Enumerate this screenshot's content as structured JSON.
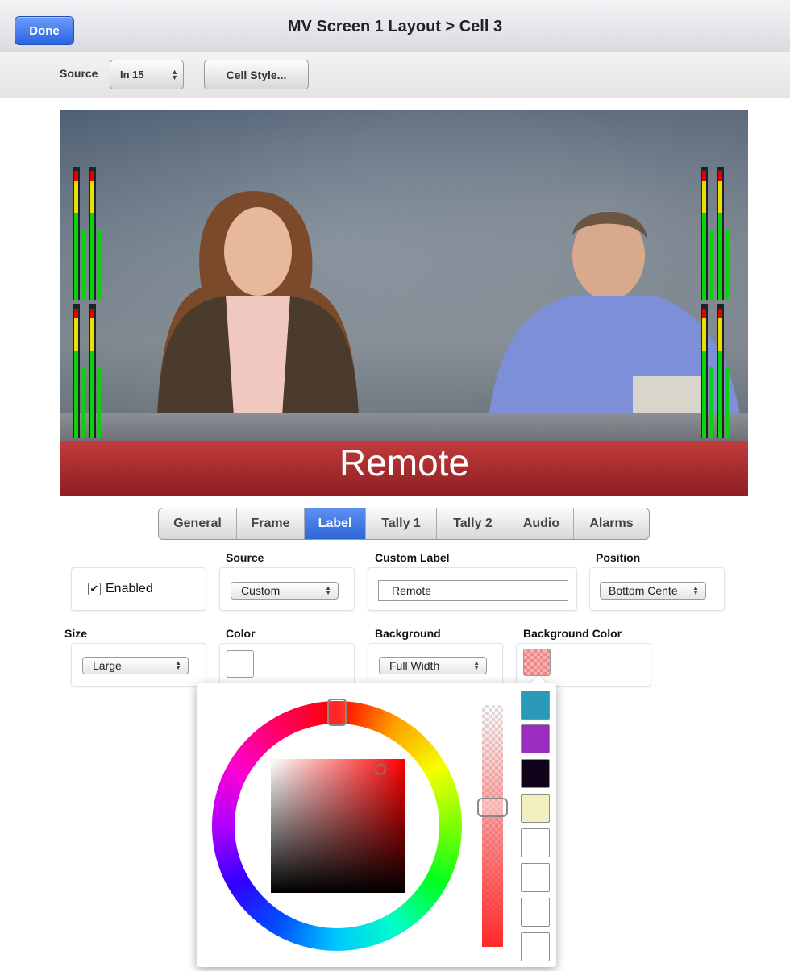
{
  "header": {
    "done_label": "Done",
    "title": "MV Screen 1 Layout > Cell 3"
  },
  "toolbar": {
    "source_label": "Source",
    "source_value": "In 15",
    "cell_style_label": "Cell Style..."
  },
  "preview": {
    "label_text": "Remote",
    "label_color": "#ffffff",
    "band_color": "#b03030"
  },
  "tabs": [
    {
      "label": "General",
      "active": false
    },
    {
      "label": "Frame",
      "active": false
    },
    {
      "label": "Label",
      "active": true
    },
    {
      "label": "Tally 1",
      "active": false
    },
    {
      "label": "Tally 2",
      "active": false
    },
    {
      "label": "Audio",
      "active": false
    },
    {
      "label": "Alarms",
      "active": false
    }
  ],
  "label_settings": {
    "enabled_label": "Enabled",
    "enabled_checked": true,
    "source_heading": "Source",
    "source_value": "Custom",
    "custom_label_heading": "Custom Label",
    "custom_label_value": "Remote",
    "position_heading": "Position",
    "position_value": "Bottom Centе",
    "size_heading": "Size",
    "size_value": "Large",
    "color_heading": "Color",
    "color_value": "#ffffff",
    "background_heading": "Background",
    "background_value": "Full Width",
    "background_color_heading": "Background Color",
    "background_color_value": "#f08080"
  },
  "color_picker": {
    "selected_hue": "#ff0000",
    "presets": [
      "#2a9ab8",
      "#9a2cc0",
      "#12021a",
      "#f3efbe",
      "#ffffff",
      "#ffffff",
      "#ffffff",
      "#ffffff"
    ]
  }
}
